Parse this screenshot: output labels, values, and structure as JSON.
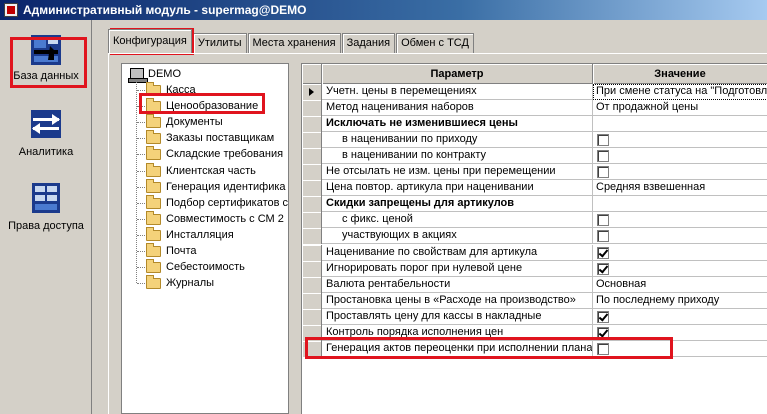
{
  "window": {
    "title": "Административный модуль - supermag@DEMO"
  },
  "nav": [
    {
      "label": "База данных",
      "icon": "database-icon"
    },
    {
      "label": "Аналитика",
      "icon": "analytics-arrows-icon"
    },
    {
      "label": "Права доступа",
      "icon": "access-rights-icon"
    }
  ],
  "tabs": [
    "Конфигурация",
    "Утилиты",
    "Места хранения",
    "Задания",
    "Обмен с ТСД"
  ],
  "tree": {
    "root": "DEMO",
    "items": [
      "Касса",
      "Ценообразование",
      "Документы",
      "Заказы поставщикам",
      "Складские требования",
      "Клиентская часть",
      "Генерация идентифика",
      "Подбор сертификатов с",
      "Совместимость с СМ 2",
      "Инсталляция",
      "Почта",
      "Себестоимость",
      "Журналы"
    ]
  },
  "grid": {
    "headers": {
      "param": "Параметр",
      "value": "Значение"
    },
    "rows": [
      {
        "param": "Учетн. цены в перемещениях",
        "value": "При смене статуса на \"Подготовле",
        "kind": "text",
        "indent": false,
        "current": true
      },
      {
        "param": "Метод наценивания наборов",
        "value": "От продажной цены",
        "kind": "text",
        "indent": false
      },
      {
        "param": "Исключать не изменившиеся цены",
        "value": "",
        "kind": "section",
        "indent": false
      },
      {
        "param": "в наценивании по приходу",
        "value": "",
        "kind": "check",
        "checked": false,
        "indent": true
      },
      {
        "param": "в наценивании по контракту",
        "value": "",
        "kind": "check",
        "checked": false,
        "indent": true
      },
      {
        "param": "Не отсылать не изм. цены при перемещении",
        "value": "",
        "kind": "check",
        "checked": false,
        "indent": false
      },
      {
        "param": "Цена повтор. артикула при наценивании",
        "value": "Средняя взвешенная",
        "kind": "text",
        "indent": false
      },
      {
        "param": "Скидки запрещены для артикулов",
        "value": "",
        "kind": "section",
        "indent": false
      },
      {
        "param": "с фикс. ценой",
        "value": "",
        "kind": "check",
        "checked": false,
        "indent": true
      },
      {
        "param": "участвующих в акциях",
        "value": "",
        "kind": "check",
        "checked": false,
        "indent": true
      },
      {
        "param": "Наценивание по свойствам для артикула",
        "value": "",
        "kind": "check",
        "checked": true,
        "indent": false
      },
      {
        "param": "Игнорировать порог при нулевой цене",
        "value": "",
        "kind": "check",
        "checked": true,
        "indent": false
      },
      {
        "param": "Валюта рентабельности",
        "value": "Основная",
        "kind": "text",
        "indent": false
      },
      {
        "param": "Простановка цены в «Расходе на производство»",
        "value": "По последнему приходу",
        "kind": "text",
        "indent": false
      },
      {
        "param": "Проставлять цену для кассы в накладные",
        "value": "",
        "kind": "check",
        "checked": true,
        "indent": false
      },
      {
        "param": "Контроль порядка исполнения цен",
        "value": "",
        "kind": "check",
        "checked": true,
        "indent": false
      },
      {
        "param": "Генерация актов переоценки при исполнении плана",
        "value": "",
        "kind": "check",
        "checked": false,
        "indent": false
      }
    ]
  },
  "colors": {
    "highlight": "#e0141e",
    "titlebar_start": "#0a246a"
  }
}
